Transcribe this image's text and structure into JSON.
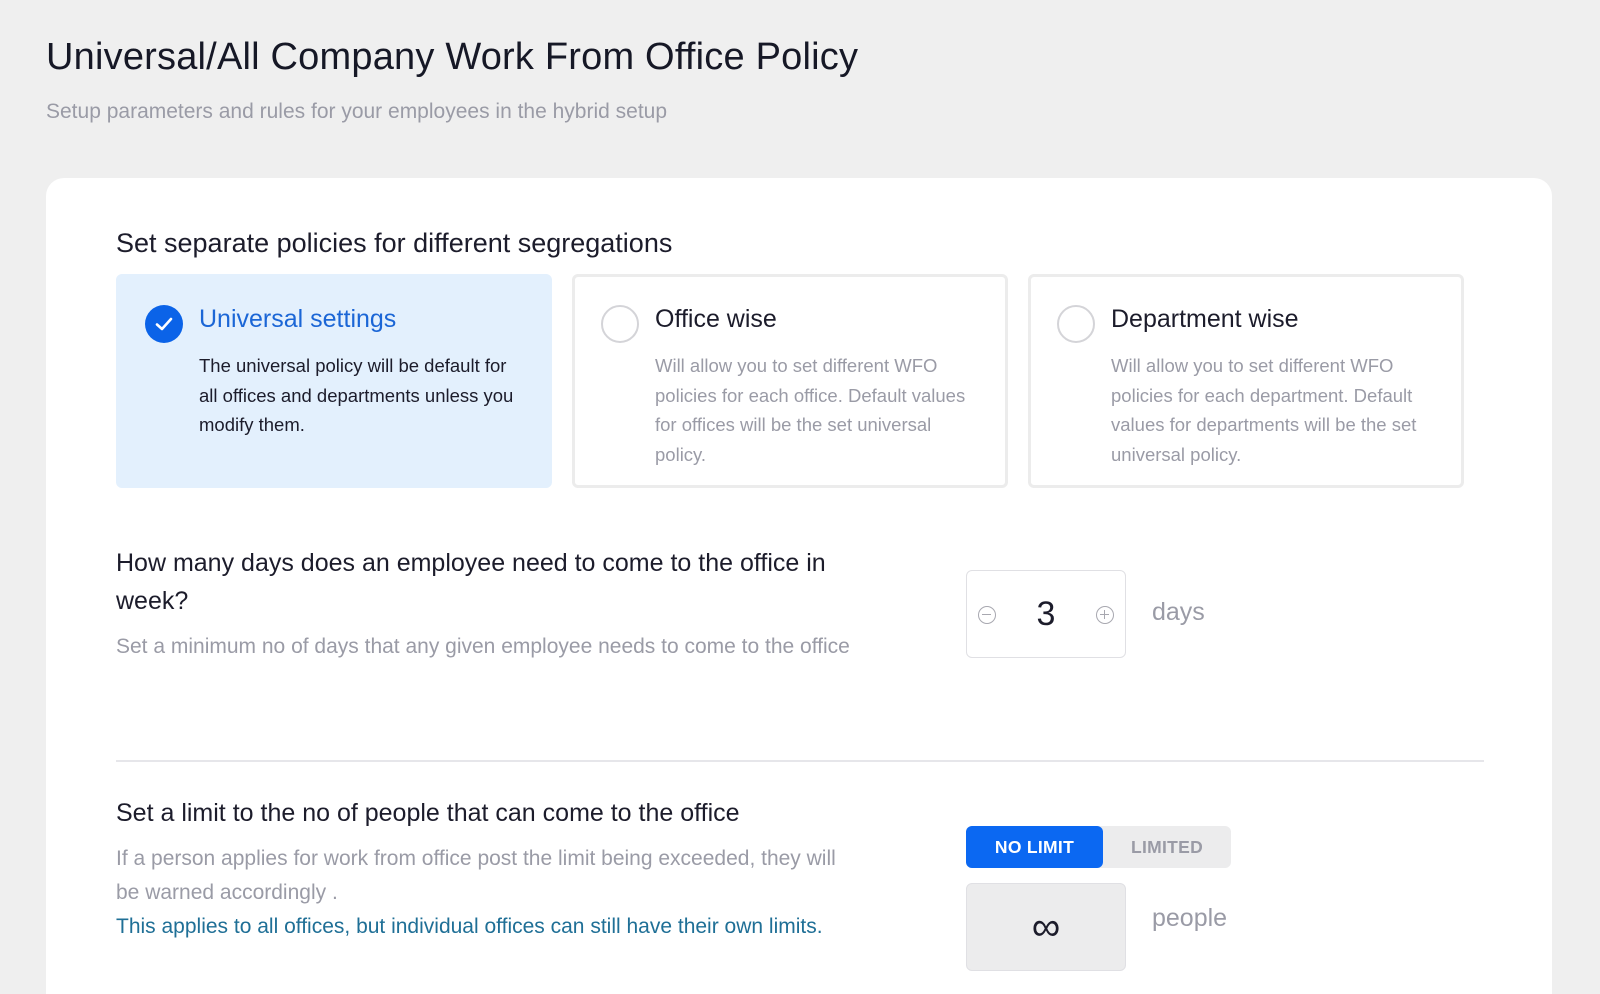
{
  "header": {
    "title": "Universal/All Company Work From Office Policy",
    "subtitle": "Setup parameters and rules for your employees in the hybrid setup"
  },
  "segregation": {
    "heading": "Set separate policies for different segregations",
    "options": [
      {
        "title": "Universal settings",
        "description": "The universal policy will be default for all offices and departments unless you modify them.",
        "selected": true
      },
      {
        "title": "Office wise",
        "description": "Will allow you to set different WFO policies for each office. Default values for offices will be the set universal policy.",
        "selected": false
      },
      {
        "title": "Department wise",
        "description": "Will allow you to set different WFO policies for each department. Default values for departments will be the set universal policy.",
        "selected": false
      }
    ]
  },
  "days_question": {
    "title": "How many days does an employee need to come to the office in week?",
    "description": "Set a minimum no of days that any given employee needs to come to the office",
    "value": "3",
    "unit": "days"
  },
  "limit_question": {
    "title": "Set a limit to the no of people that can come to the office",
    "description": "If a person applies for work from office post the limit being exceeded, they will be warned accordingly .",
    "note": "This applies to all offices, but individual offices can still have their own limits.",
    "toggle": {
      "active_label": "NO LIMIT",
      "inactive_label": "LIMITED"
    },
    "value": "∞",
    "unit": "people"
  },
  "colors": {
    "accent": "#0b68f2",
    "selected_bg": "#e3f0fd",
    "note_text": "#1f6f96"
  }
}
